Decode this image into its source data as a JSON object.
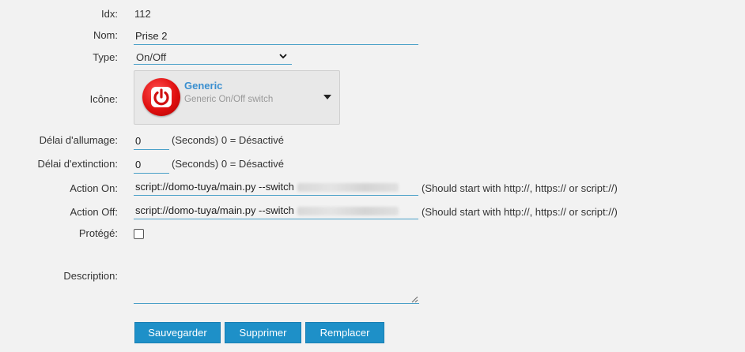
{
  "idx": {
    "label": "Idx:",
    "value": "112"
  },
  "nom": {
    "label": "Nom:",
    "value": "Prise 2"
  },
  "type": {
    "label": "Type:",
    "selected": "On/Off"
  },
  "icone": {
    "label": "Icône:",
    "title": "Generic",
    "subtitle": "Generic On/Off switch",
    "icon": "power-icon",
    "color": "#e01010"
  },
  "delai_allumage": {
    "label": "Délai d'allumage:",
    "value": "0",
    "hint": "(Seconds) 0 = Désactivé"
  },
  "delai_extinction": {
    "label": "Délai d'extinction:",
    "value": "0",
    "hint": "(Seconds) 0 = Désactivé"
  },
  "action_on": {
    "label": "Action On:",
    "value": "script://domo-tuya/main.py --switch",
    "hint": "(Should start with http://, https:// or script://)"
  },
  "action_off": {
    "label": "Action Off:",
    "value": "script://domo-tuya/main.py --switch",
    "hint": "(Should start with http://, https:// or script://)"
  },
  "protege": {
    "label": "Protégé:",
    "checked": false
  },
  "description": {
    "label": "Description:",
    "value": ""
  },
  "buttons": {
    "save": "Sauvegarder",
    "delete": "Supprimer",
    "replace": "Remplacer"
  },
  "colors": {
    "accent": "#1e90c8",
    "underline": "#4aa0c8",
    "link": "#3a8fd0"
  }
}
